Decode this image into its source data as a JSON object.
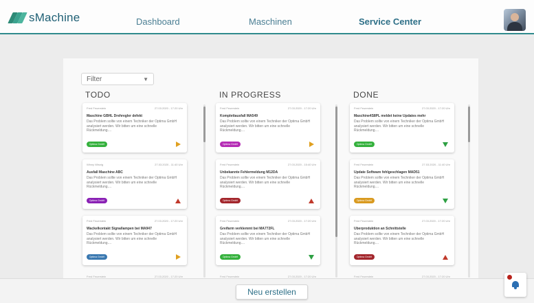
{
  "header": {
    "logo_text": "sMachine",
    "nav": [
      {
        "label": "Dashboard",
        "active": false
      },
      {
        "label": "Maschinen",
        "active": false
      },
      {
        "label": "Service Center",
        "active": true
      }
    ],
    "avatar_icon": "user-avatar"
  },
  "filter": {
    "label": "Filter",
    "icon": "chevron-down-icon"
  },
  "columns": [
    {
      "title": "TODO",
      "cards": [
        {
          "meta_left": "Fred Feuerstein",
          "meta_right": "27.03.2020 - 17:20 Uhr",
          "title": "Maschine GBHL Drehregler defekt",
          "desc": "Das Problem sollte von einem Techniker der Optima GmbH analysiert werden. Wir bitten um eine schnelle Rückmeldung....",
          "tag": "Optima GmbH",
          "tag_color": "#35b13d",
          "status_icon": "play-right-icon"
        },
        {
          "meta_left": "Winny Winzig",
          "meta_right": "27.03.2020 - 11:40 Uhr",
          "title": "Ausfall Maschine ABC",
          "desc": "Das Problem sollte von einem Techniker der Optima GmbH analysiert werden. Wir bitten um eine schnelle Rückmeldung....",
          "tag": "Optima GmbH",
          "tag_color": "#8a21b5",
          "status_icon": "triangle-up-icon"
        },
        {
          "meta_left": "Fred Feuerstein",
          "meta_right": "27.03.2020 - 17:20 Uhr",
          "title": "Wackelkontakt Signallampen bei MA947",
          "desc": "Das Problem sollte von einem Techniker der Optima GmbH analysiert werden. Wir bitten um eine schnelle Rückmeldung....",
          "tag": "Optima GmbH",
          "tag_color": "#3a78b0",
          "status_icon": "play-right-icon"
        }
      ],
      "peek_left": "Fred Feuerstein",
      "peek_right": "27.03.2020 - 17:20 Uhr"
    },
    {
      "title": "IN PROGRESS",
      "cards": [
        {
          "meta_left": "Fred Feuerstein",
          "meta_right": "27.03.2020 - 17:20 Uhr",
          "title": "Komplettausfall MA549",
          "desc": "Das Problem sollte von einem Techniker der Optima GmbH analysiert werden. Wir bitten um eine schnelle Rückmeldung....",
          "tag": "Optima GmbH",
          "tag_color": "#b52cb5",
          "status_icon": "play-right-icon"
        },
        {
          "meta_left": "Fred Feuerstein",
          "meta_right": "27.03.2020 - 15:40 Uhr",
          "title": "Unbekannte Fehlermeldung M12DA",
          "desc": "Das Problem sollte von einem Techniker der Optima GmbH analysiert werden. Wir bitten um eine schnelle Rückmeldung....",
          "tag": "Optima GmbH",
          "tag_color": "#a3262c",
          "status_icon": "triangle-up-icon"
        },
        {
          "meta_left": "Fred Feuerstein",
          "meta_right": "27.03.2020 - 17:20 Uhr",
          "title": "Greifarm verklemmt bei MA772FL",
          "desc": "Das Problem sollte von einem Techniker der Optima GmbH analysiert werden. Wir bitten um eine schnelle Rückmeldung....",
          "tag": "Optima GmbH",
          "tag_color": "#35b13d",
          "status_icon": "triangle-down-icon"
        }
      ],
      "peek_left": "Fred Feuerstein",
      "peek_right": "27.03.2020 - 17:20 Uhr"
    },
    {
      "title": "DONE",
      "cards": [
        {
          "meta_left": "Fred Feuerstein",
          "meta_right": "27.03.2020 - 17:20 Uhr",
          "title": "Maschine4S8PL meldet keine Updates mehr",
          "desc": "Das Problem sollte von einem Techniker der Optima GmbH analysiert werden. Wir bitten um eine schnelle Rückmeldung....",
          "tag": "Optima GmbH",
          "tag_color": "#35b13d",
          "status_icon": "triangle-down-icon"
        },
        {
          "meta_left": "Fred Feuerstein",
          "meta_right": "27.03.2020 - 11:40 Uhr",
          "title": "Update Software fehlgeschlagen MAD51",
          "desc": "Das Problem sollte von einem Techniker der Optima GmbH analysiert werden. Wir bitten um eine schnelle Rückmeldung....",
          "tag": "Optima GmbH",
          "tag_color": "#d99a20",
          "status_icon": "triangle-down-icon"
        },
        {
          "meta_left": "Fred Feuerstein",
          "meta_right": "27.03.2020 - 17:20 Uhr",
          "title": "Überproduktion an Schnittstelle",
          "desc": "Das Problem sollte von einem Techniker der Optima GmbH analysiert werden. Wir bitten um eine schnelle Rückmeldung....",
          "tag": "Optima GmbH",
          "tag_color": "#a3262c",
          "status_icon": "triangle-up-icon"
        }
      ],
      "peek_left": "Fred Feuerstein",
      "peek_right": "27.03.2020 - 17:20 Uhr"
    }
  ],
  "actions": {
    "create_label": "Neu erstellen",
    "notification_icon": "bell-icon"
  },
  "colors": {
    "accent": "#2f8a8c",
    "brand_text": "#1e5f74",
    "warning": "#e0a020",
    "danger": "#c0392b",
    "success": "#2ea043"
  }
}
